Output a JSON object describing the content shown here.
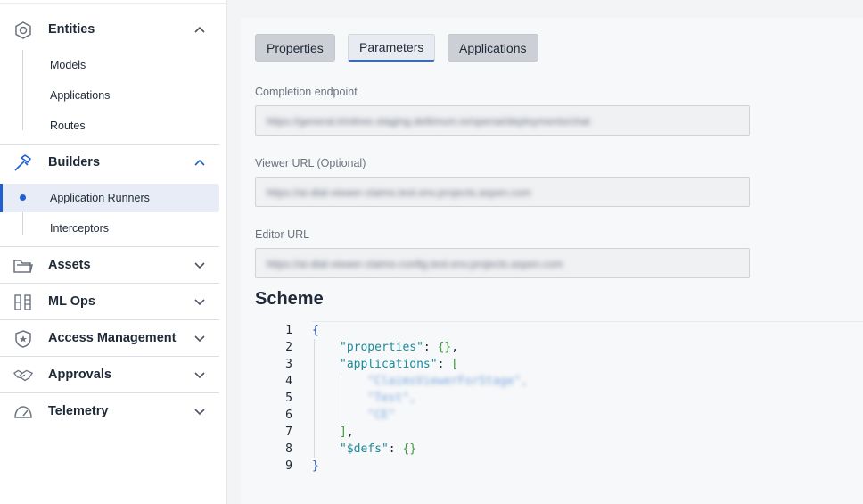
{
  "sidebar": {
    "entities": {
      "label": "Entities",
      "icon": "hexagon-icon",
      "expanded": true,
      "items": [
        {
          "label": "Models"
        },
        {
          "label": "Applications"
        },
        {
          "label": "Routes"
        }
      ]
    },
    "builders": {
      "label": "Builders",
      "icon": "hammer-icon",
      "expanded": true,
      "items": [
        {
          "label": "Application Runners",
          "active": true
        },
        {
          "label": "Interceptors"
        }
      ]
    },
    "collapsed": [
      {
        "label": "Assets",
        "icon": "folder-icon"
      },
      {
        "label": "ML Ops",
        "icon": "ml-ops-icon"
      },
      {
        "label": "Access Management",
        "icon": "shield-star-icon"
      },
      {
        "label": "Approvals",
        "icon": "handshake-icon"
      },
      {
        "label": "Telemetry",
        "icon": "gauge-icon"
      }
    ]
  },
  "tabs": [
    {
      "label": "Properties",
      "active": false
    },
    {
      "label": "Parameters",
      "active": true
    },
    {
      "label": "Applications",
      "active": false
    }
  ],
  "fields": {
    "completion": {
      "label": "Completion endpoint",
      "value": "https://general.trinitree.staging.deltimum.io/openai/deployments/chat"
    },
    "viewer": {
      "label": "Viewer URL",
      "optional": "(Optional)",
      "value": "https://ai-dial-viewer-claims.test.env.projects.aspen.com"
    },
    "editor": {
      "label": "Editor URL",
      "value": "https://ai-dial-viewer-claims-config.test.env.projects.aspen.com"
    }
  },
  "scheme": {
    "title": "Scheme",
    "line_numbers": [
      "1",
      "2",
      "3",
      "4",
      "5",
      "6",
      "7",
      "8",
      "9"
    ],
    "tokens": {
      "open_brace": "{",
      "close_brace": "}",
      "properties_key": "\"properties\"",
      "applications_key": "\"applications\"",
      "defs_key": "\"$defs\"",
      "colon": ": ",
      "empty_obj": "{}",
      "comma": ",",
      "open_bracket": "[",
      "close_bracket": "]"
    },
    "blurred_items": [
      "\"ClaimsViewerForStage\",",
      "\"Test\",",
      "\"CE\""
    ]
  },
  "colors": {
    "accent": "#2f6bd8",
    "json_key": "#1a8a9a",
    "json_brace": "#2452b8",
    "json_object": "#3a9a3a"
  }
}
